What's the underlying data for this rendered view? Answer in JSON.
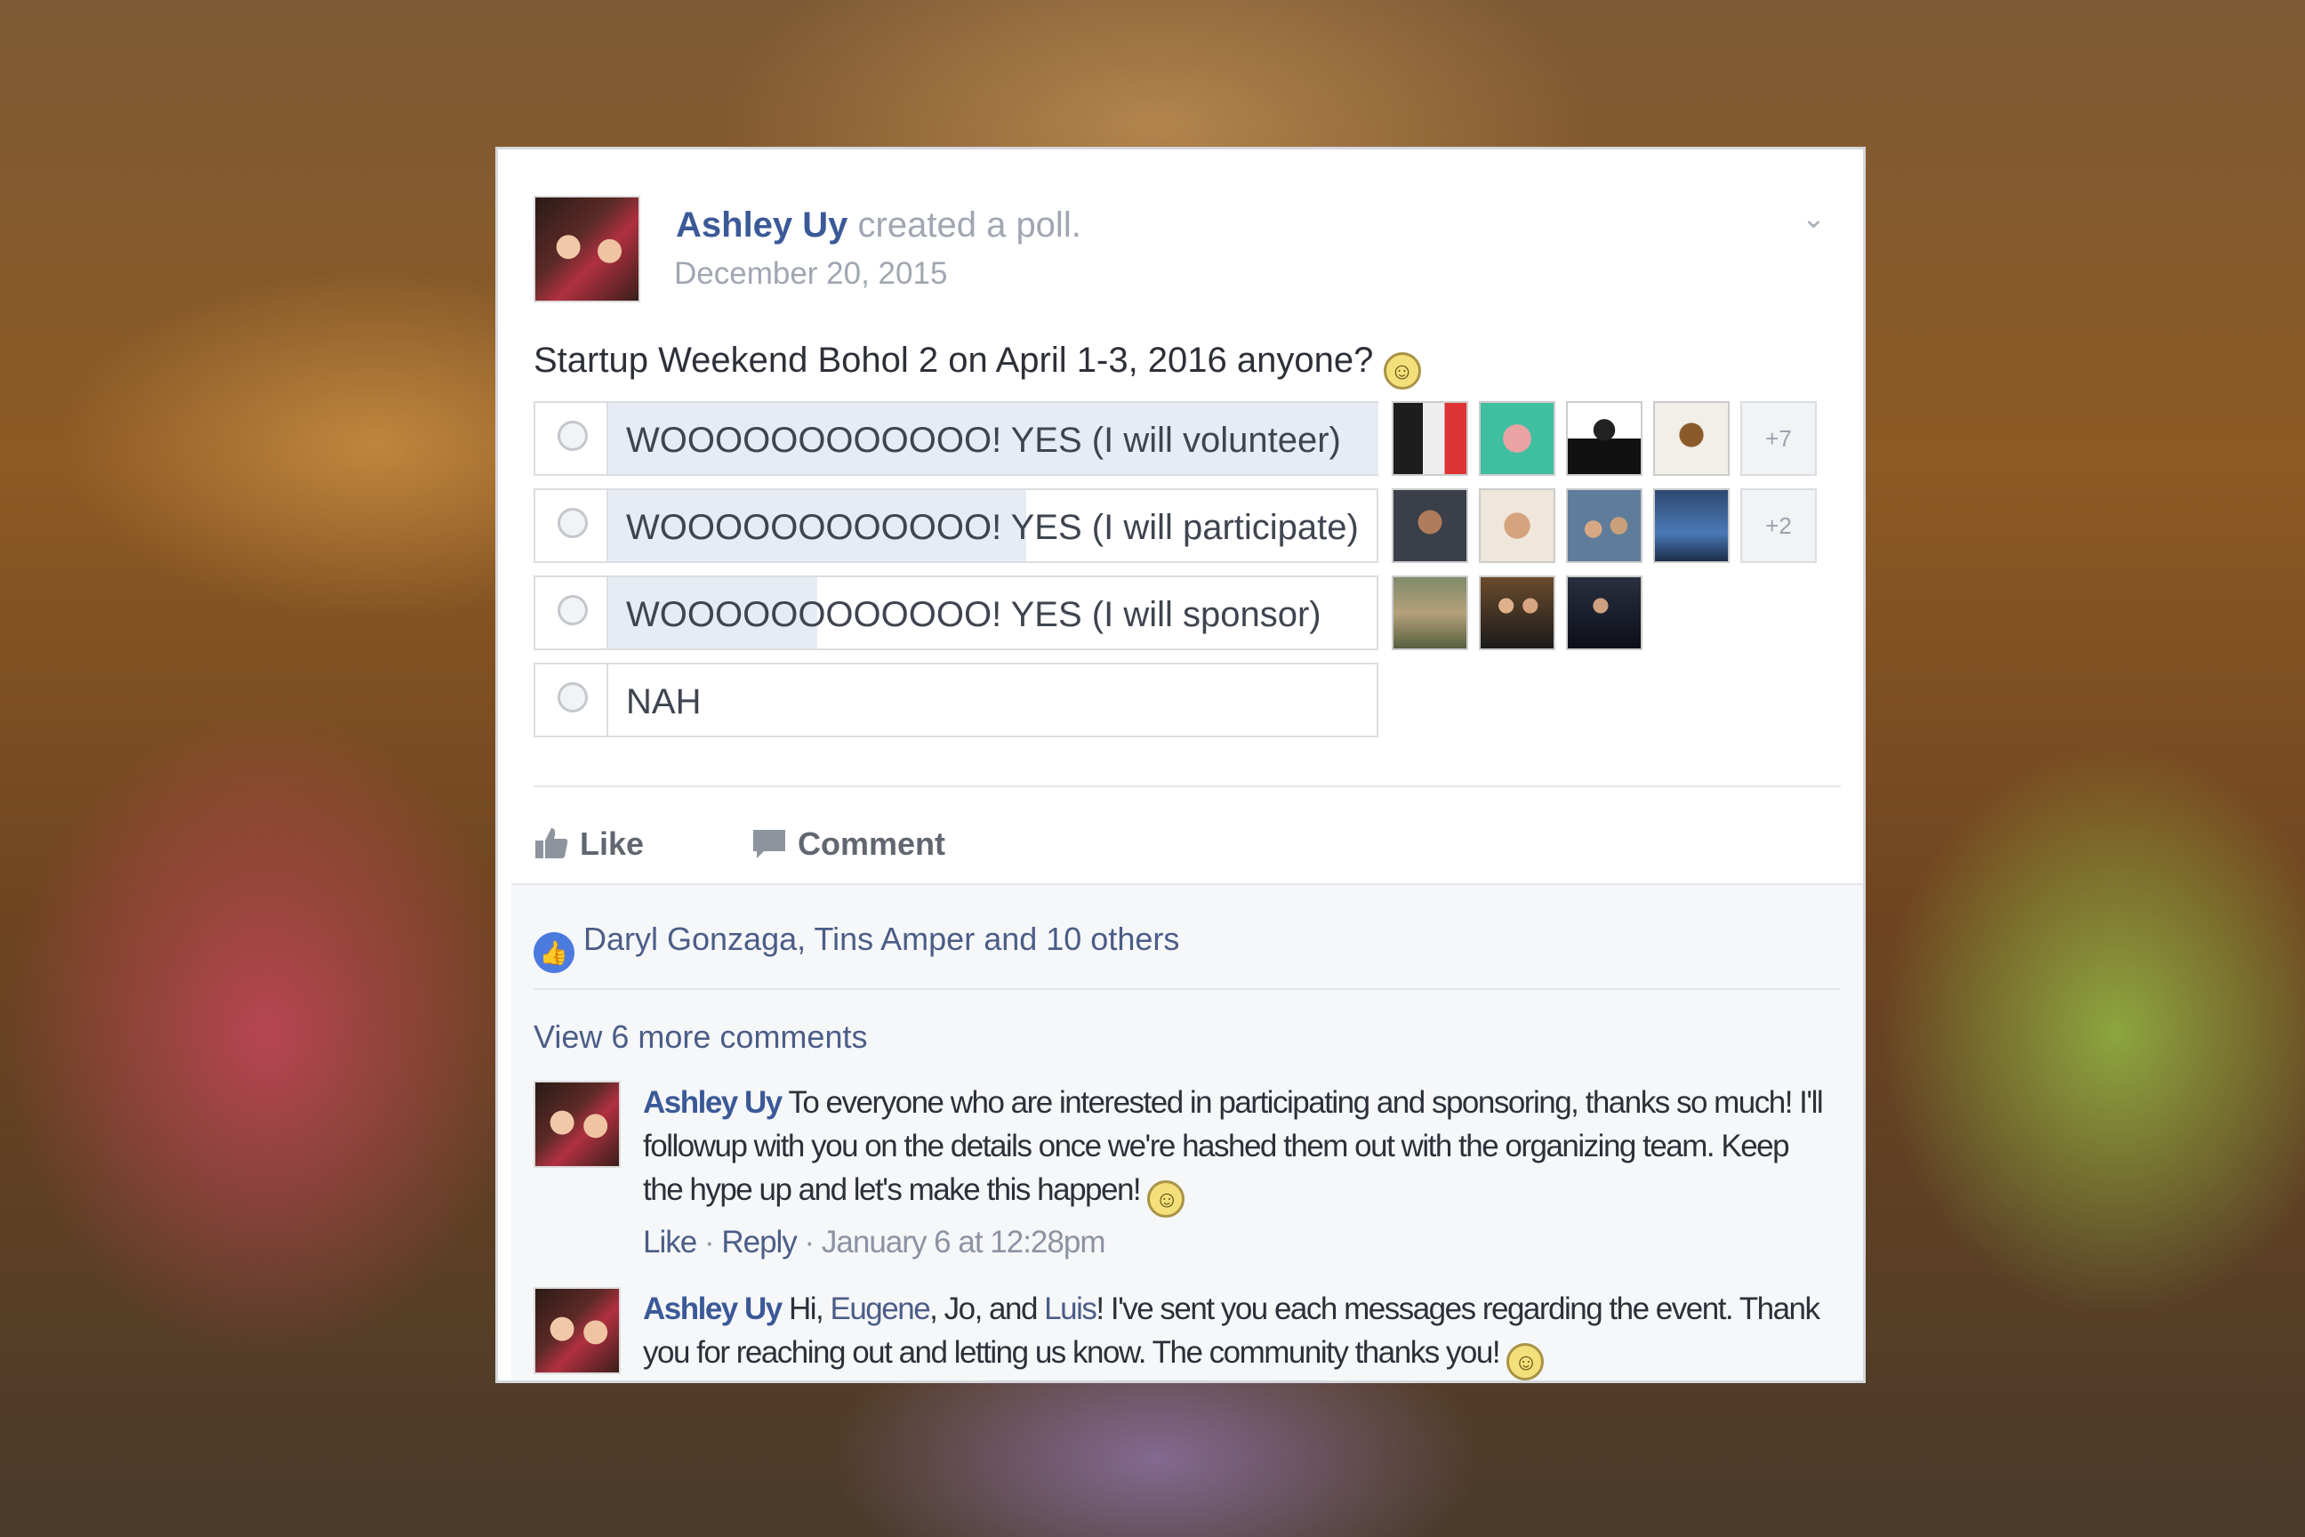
{
  "post": {
    "author": "Ashley Uy",
    "action": "created a poll.",
    "date": "December 20, 2015",
    "question": "Startup Weekend Bohol 2 on April 1-3, 2016 anyone?",
    "emoji": "smiley-face"
  },
  "poll": {
    "options": [
      {
        "label": "WOOOOOOOOOOOO! YES (I will volunteer)",
        "fill_fraction": 1.0,
        "extra_voters": "+7"
      },
      {
        "label": "WOOOOOOOOOOOO! YES (I will participate)",
        "fill_fraction": 0.55,
        "extra_voters": "+2"
      },
      {
        "label": "WOOOOOOOOOOOO! YES (I will sponsor)",
        "fill_fraction": 0.27,
        "extra_voters": ""
      },
      {
        "label": "NAH",
        "fill_fraction": 0.0,
        "extra_voters": ""
      }
    ]
  },
  "actions": {
    "like": "Like",
    "comment": "Comment"
  },
  "likes": {
    "text": "Daryl Gonzaga, Tins Amper and 10 others"
  },
  "comments": {
    "view_more": "View 6 more comments",
    "items": [
      {
        "author": "Ashley Uy",
        "text": "To everyone who are interested in participating and sponsoring, thanks so much! I'll followup with you on the details once we're hashed them out with the organizing team. Keep the hype up and let's make this happen!",
        "like": "Like",
        "reply": "Reply",
        "time": "January 6 at 12:28pm"
      },
      {
        "author": "Ashley Uy",
        "text_prefix": "Hi,",
        "mention1": "Eugene",
        "mid1": ", Jo, and",
        "mention2": "Luis",
        "text_suffix": "! I've sent you each messages regarding the event. Thank you for reaching out and letting us know. The community thanks you!"
      }
    ]
  },
  "colors": {
    "link": "#3b5998",
    "poll_fill": "#e7ebf3",
    "like_badge": "#4c7be0"
  }
}
